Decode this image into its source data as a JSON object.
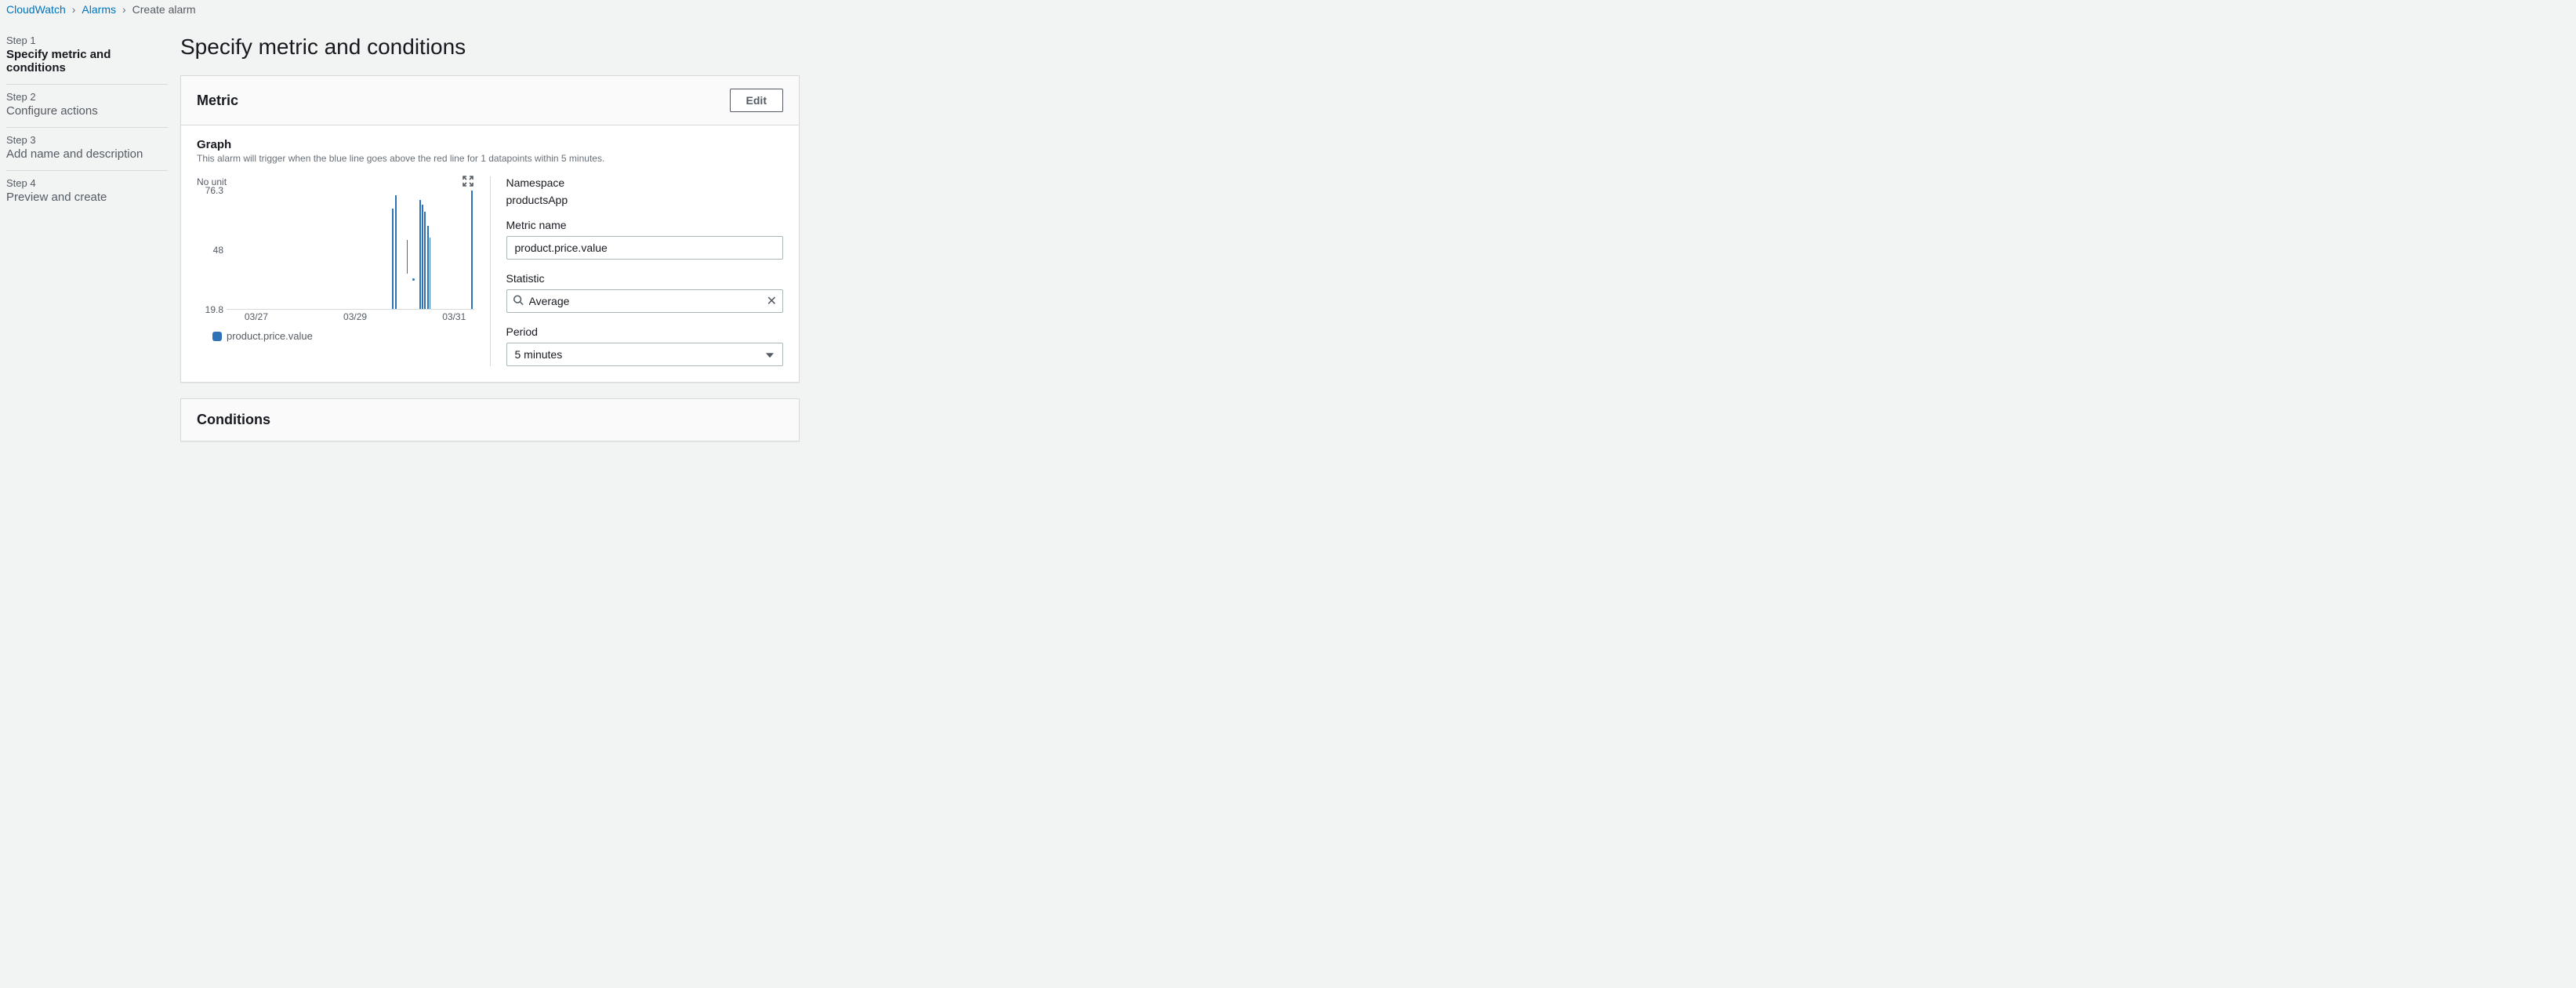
{
  "breadcrumb": {
    "items": [
      {
        "label": "CloudWatch",
        "link": true
      },
      {
        "label": "Alarms",
        "link": true
      },
      {
        "label": "Create alarm",
        "link": false
      }
    ]
  },
  "wizard": {
    "steps": [
      {
        "num": "Step 1",
        "title": "Specify metric and conditions",
        "active": true
      },
      {
        "num": "Step 2",
        "title": "Configure actions",
        "active": false
      },
      {
        "num": "Step 3",
        "title": "Add name and description",
        "active": false
      },
      {
        "num": "Step 4",
        "title": "Preview and create",
        "active": false
      }
    ]
  },
  "page": {
    "title": "Specify metric and conditions"
  },
  "metric_panel": {
    "header": "Metric",
    "edit_label": "Edit",
    "graph": {
      "title": "Graph",
      "description": "This alarm will trigger when the blue line goes above the red line for 1 datapoints within 5 minutes.",
      "unit": "No unit",
      "legend": "product.price.value"
    },
    "fields": {
      "namespace_label": "Namespace",
      "namespace_value": "productsApp",
      "metric_name_label": "Metric name",
      "metric_name_value": "product.price.value",
      "statistic_label": "Statistic",
      "statistic_value": "Average",
      "period_label": "Period",
      "period_value": "5 minutes"
    }
  },
  "conditions_panel": {
    "header": "Conditions"
  },
  "chart_data": {
    "type": "line",
    "title": "",
    "ylabel": "",
    "unit": "No unit",
    "ylim": [
      19.8,
      76.3
    ],
    "y_ticks": [
      19.8,
      48,
      76.3
    ],
    "x_type": "time",
    "x_ticks": [
      "03/27",
      "03/29",
      "03/31"
    ],
    "series": [
      {
        "name": "product.price.value",
        "color": "#2e73b8",
        "points": [
          {
            "x": "03/29 18:00",
            "low": 20,
            "high": 68
          },
          {
            "x": "03/29 20:00",
            "low": 20,
            "high": 74
          },
          {
            "x": "03/30 00:00",
            "low": 36,
            "high": 40
          },
          {
            "x": "03/30 04:00",
            "low": 20,
            "high": 72
          },
          {
            "x": "03/30 05:00",
            "low": 20,
            "high": 70
          },
          {
            "x": "03/30 06:00",
            "low": 22,
            "high": 68
          },
          {
            "x": "03/30 07:00",
            "low": 20,
            "high": 60
          },
          {
            "x": "03/30 08:00",
            "low": 33,
            "high": 34
          },
          {
            "x": "03/31 00:00",
            "low": 20,
            "high": 76.3
          }
        ]
      }
    ]
  }
}
